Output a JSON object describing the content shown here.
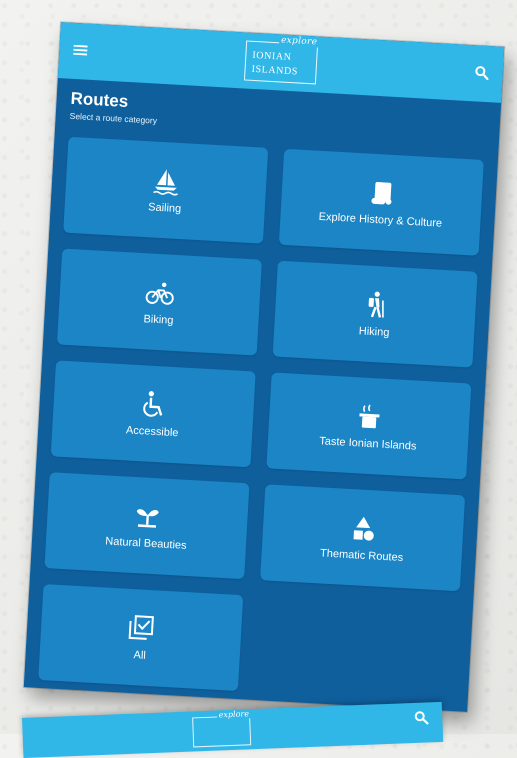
{
  "app": {
    "logo_small": "explore",
    "logo_line1": "IONIAN",
    "logo_line2": "ISLANDS",
    "menu_icon": "menu-icon",
    "search_icon": "search-icon",
    "accent_color": "#31b6e8",
    "background_color": "#0f5f9d",
    "tile_color": "#1b85c5"
  },
  "page": {
    "title": "Routes",
    "subtitle": "Select a route category"
  },
  "categories": [
    {
      "label": "Sailing",
      "icon": "sailboat-icon"
    },
    {
      "label": "Explore History & Culture",
      "icon": "scroll-icon"
    },
    {
      "label": "Biking",
      "icon": "bike-icon"
    },
    {
      "label": "Hiking",
      "icon": "hiker-icon"
    },
    {
      "label": "Accessible",
      "icon": "wheelchair-icon"
    },
    {
      "label": "Taste Ionian Islands",
      "icon": "cooking-pot-icon"
    },
    {
      "label": "Natural Beauties",
      "icon": "sprout-icon"
    },
    {
      "label": "Thematic Routes",
      "icon": "shapes-icon"
    },
    {
      "label": "All",
      "icon": "checkbox-stack-icon"
    }
  ],
  "second_screen": {
    "logo_small": "explore"
  }
}
